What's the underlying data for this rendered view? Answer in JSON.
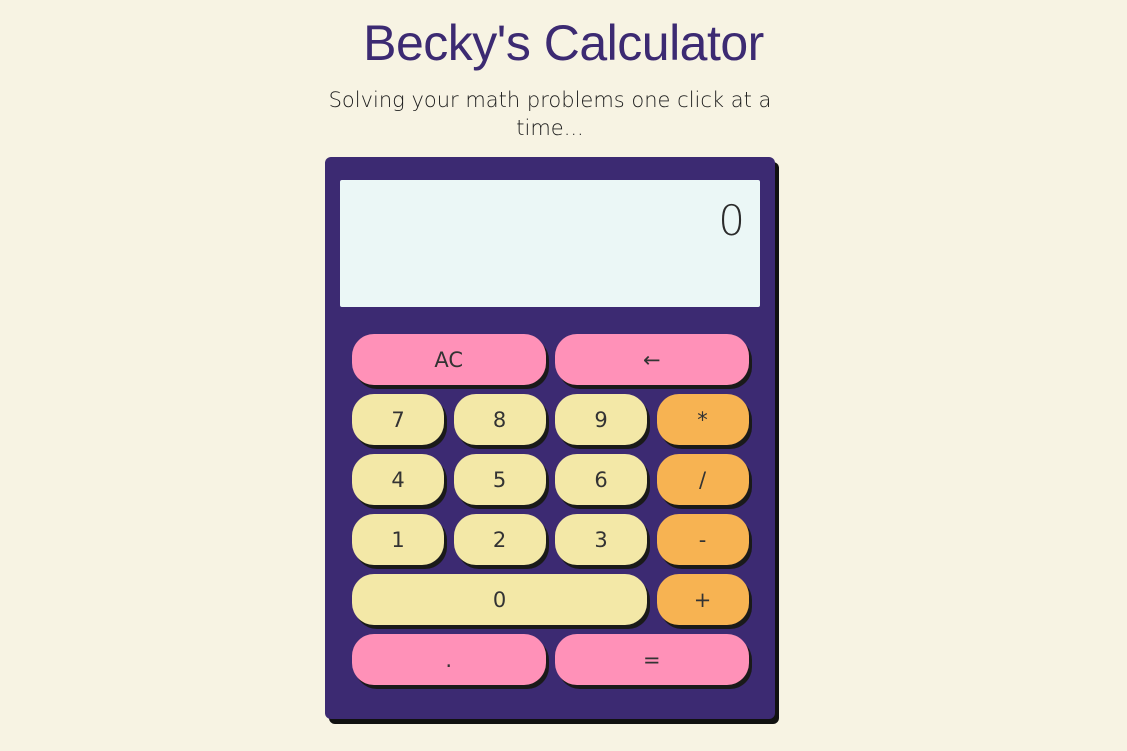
{
  "header": {
    "title": "Becky's Calculator",
    "subtitle": "Solving your math problems one click at a time..."
  },
  "display": {
    "value": "0"
  },
  "colors": {
    "background": "#f7f3e3",
    "calculator_body": "#3c2a72",
    "display": "#ebf7f6",
    "function_key": "#ff91b8",
    "number_key": "#f3e8a7",
    "operator_key": "#f7b352"
  },
  "keys": {
    "clear": "AC",
    "backspace": "←",
    "seven": "7",
    "eight": "8",
    "nine": "9",
    "multiply": "*",
    "four": "4",
    "five": "5",
    "six": "6",
    "divide": "/",
    "one": "1",
    "two": "2",
    "three": "3",
    "subtract": "-",
    "zero": "0",
    "add": "+",
    "decimal": ".",
    "equals": "="
  }
}
